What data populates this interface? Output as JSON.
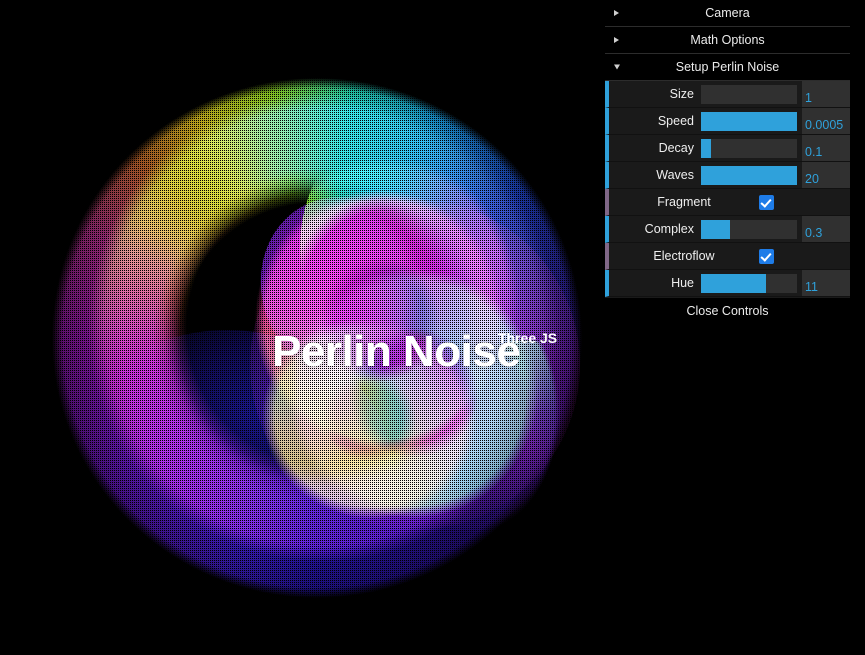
{
  "viewport": {
    "title": "Perlin Noise",
    "subtitle": "Three JS",
    "background": "#000000"
  },
  "gui": {
    "folders": [
      {
        "name": "Camera",
        "label": "Camera",
        "expanded": false,
        "icon": "chevron-right-icon"
      },
      {
        "name": "Math Options",
        "label": "Math Options",
        "expanded": false,
        "icon": "chevron-right-icon"
      },
      {
        "name": "Setup Perlin Noise",
        "label": "Setup Perlin Noise",
        "expanded": true,
        "icon": "chevron-down-icon"
      }
    ],
    "controls": [
      {
        "label": "Size",
        "type": "slider",
        "value": "1",
        "fill_percent": 0
      },
      {
        "label": "Speed",
        "type": "slider",
        "value": "0.0005",
        "fill_percent": 100
      },
      {
        "label": "Decay",
        "type": "slider",
        "value": "0.1",
        "fill_percent": 10
      },
      {
        "label": "Waves",
        "type": "slider",
        "value": "20",
        "fill_percent": 100
      },
      {
        "label": "Fragment",
        "type": "checkbox",
        "value": "true",
        "checked": true
      },
      {
        "label": "Complex",
        "type": "slider",
        "value": "0.3",
        "fill_percent": 30
      },
      {
        "label": "Electroflow",
        "type": "checkbox",
        "value": "true",
        "checked": true
      },
      {
        "label": "Hue",
        "type": "slider",
        "value": "11",
        "fill_percent": 68
      }
    ],
    "close_label": "Close Controls",
    "colors": {
      "slider_accent": "#2fa1db",
      "checkbox_accent": "#806787",
      "checkbox_fill": "#1e7ce8",
      "value_text": "#2fa1db",
      "row_background": "#1a1a1a",
      "track_background": "#303030",
      "panel_background": "#000000",
      "label_text": "#eeeeee"
    }
  }
}
